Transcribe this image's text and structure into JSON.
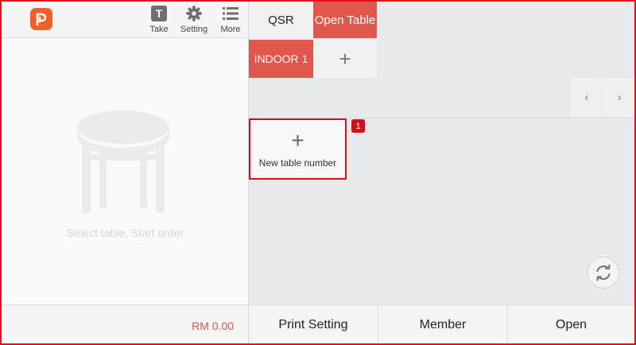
{
  "toolbar": {
    "take_label": "Take",
    "take_glyph": "T",
    "setting_label": "Setting",
    "more_label": "More"
  },
  "left_panel": {
    "empty_text": "Select table, Start order",
    "total": "RM 0.00"
  },
  "tabs": [
    {
      "label": "QSR",
      "active": false
    },
    {
      "label": "Open Table",
      "active": true
    }
  ],
  "areas": {
    "items": [
      {
        "label": "INDOOR 1"
      }
    ],
    "add_glyph": "+"
  },
  "pager": {
    "prev": "‹",
    "next": "›"
  },
  "new_table": {
    "glyph": "+",
    "label": "New table number",
    "badge": "1"
  },
  "bottom_bar": {
    "print_setting": "Print Setting",
    "member": "Member",
    "open": "Open"
  },
  "colors": {
    "accent": "#e2574c",
    "highlight": "#d0111c",
    "logo": "#f25f29"
  }
}
